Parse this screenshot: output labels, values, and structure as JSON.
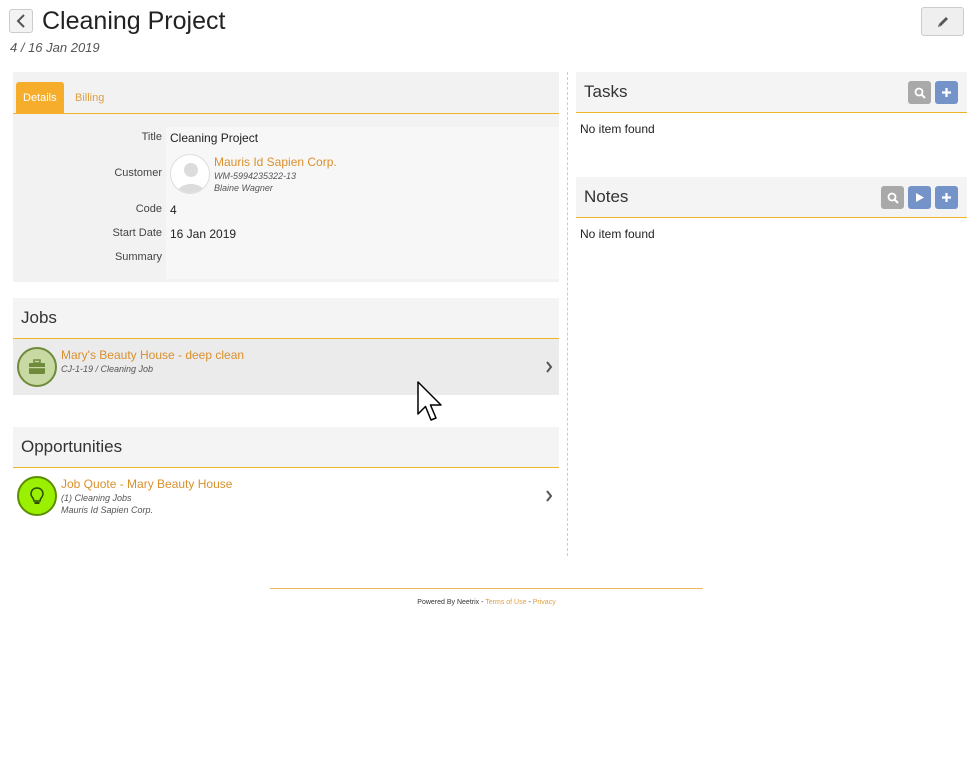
{
  "header": {
    "title": "Cleaning Project",
    "subtitle": "4 / 16 Jan 2019"
  },
  "tabs": [
    {
      "label": "Details",
      "active": true
    },
    {
      "label": "Billing",
      "active": false
    }
  ],
  "details": {
    "title_label": "Title",
    "title_value": "Cleaning Project",
    "customer_label": "Customer",
    "customer": {
      "name": "Mauris Id Sapien Corp.",
      "id": "WM-5994235322-13",
      "contact": "Blaine Wagner"
    },
    "code_label": "Code",
    "code_value": "4",
    "start_label": "Start Date",
    "start_value": "16 Jan 2019",
    "summary_label": "Summary",
    "summary_value": ""
  },
  "jobs": {
    "heading": "Jobs",
    "items": [
      {
        "title": "Mary's Beauty House - deep clean",
        "sub": "CJ-1-19 / Cleaning Job"
      }
    ]
  },
  "opportunities": {
    "heading": "Opportunities",
    "items": [
      {
        "title": "Job Quote - Mary Beauty House",
        "sub": "(1) Cleaning Jobs",
        "sub2": "Mauris Id Sapien Corp."
      }
    ]
  },
  "tasks": {
    "heading": "Tasks",
    "empty": "No item found"
  },
  "notes": {
    "heading": "Notes",
    "empty": "No item found"
  },
  "footer": {
    "powered": "Powered By Neetrix -",
    "terms": "Terms of Use",
    "sep": "-",
    "privacy": "Privacy"
  },
  "colors": {
    "accent": "#f5ad2b",
    "link": "#d9902c",
    "button_blue": "#7393c9",
    "button_gray": "#a9a9a9"
  }
}
